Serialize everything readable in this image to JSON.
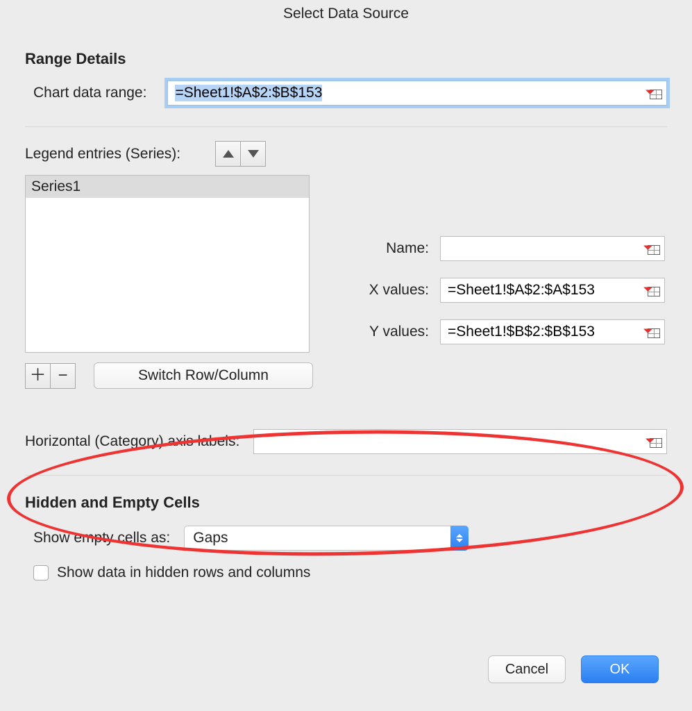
{
  "title": "Select Data Source",
  "range_details": {
    "heading": "Range Details",
    "chart_data_range_label": "Chart data range:",
    "chart_data_range_value": "=Sheet1!$A$2:$B$153"
  },
  "legend": {
    "label": "Legend entries (Series):",
    "series": [
      "Series1"
    ],
    "switch_label": "Switch Row/Column"
  },
  "series_props": {
    "name_label": "Name:",
    "name_value": "",
    "x_label": "X values:",
    "x_value": "=Sheet1!$A$2:$A$153",
    "y_label": "Y values:",
    "y_value": "=Sheet1!$B$2:$B$153"
  },
  "hlabels": {
    "label": "Horizontal (Category) axis labels:",
    "value": ""
  },
  "hidden_empty": {
    "heading": "Hidden and Empty Cells",
    "show_empty_label": "Show empty cells as:",
    "show_empty_value": "Gaps",
    "show_hidden_label": "Show data in hidden rows and columns"
  },
  "buttons": {
    "cancel": "Cancel",
    "ok": "OK"
  }
}
